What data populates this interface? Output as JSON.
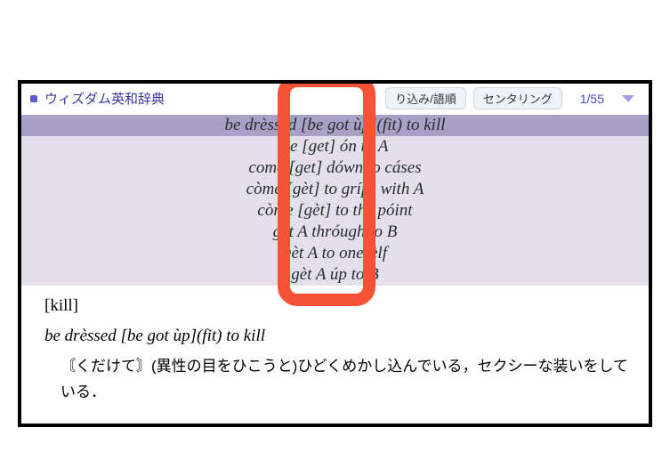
{
  "header": {
    "dict_title": "ウィズダム英和辞典",
    "btn_filter": "り込み/語順",
    "btn_center": "センタリング",
    "page_indicator": "1/55"
  },
  "results": [
    "be drèssed [be got ùp](fit) to kill",
    "be [get] ón to A",
    "come [get] dówn to cáses",
    "còme [gèt] to gríps with A",
    "còme [gèt] to the póint",
    "gèt A thróugh to B",
    "gèt A to onesèlf",
    "gèt A úp to B"
  ],
  "detail": {
    "bracket": "[kill]",
    "headword": "be drèssed [be got ùp](fit) to kill",
    "definition": "〘くだけて〙(異性の目をひこうと)ひどくめかし込んでいる，セクシーな装いをしている．"
  }
}
